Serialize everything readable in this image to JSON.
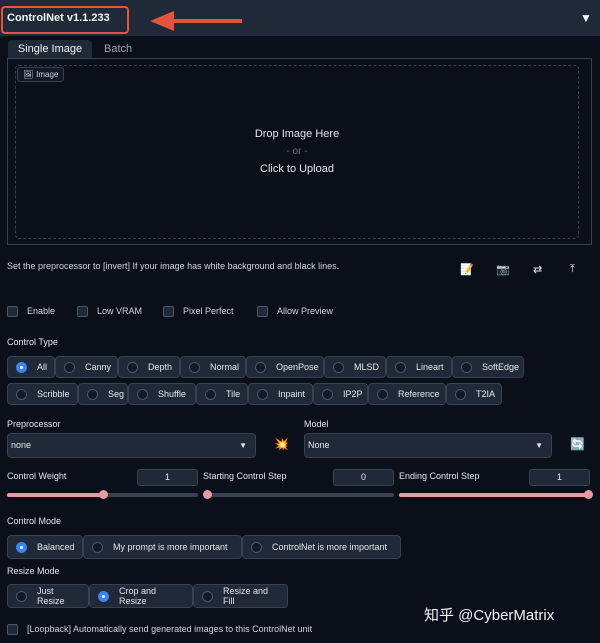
{
  "header": {
    "title": "ControlNet v1.1.233",
    "collapse_icon": "▼"
  },
  "tabs": [
    {
      "label": "Single Image"
    },
    {
      "label": "Batch"
    }
  ],
  "image_input": {
    "label": "Image",
    "drop_text": "Drop Image Here",
    "or_text": "- or -",
    "upload_text": "Click to Upload"
  },
  "hint": "Set the preprocessor to [invert] If your image has white background and black lines.",
  "toolbar": {
    "icons": [
      "edit-icon",
      "camera-icon",
      "swap-icon",
      "upload-arrow-icon"
    ],
    "glyphs": [
      "📝",
      "📷",
      "⇄",
      "⤒"
    ]
  },
  "options": [
    {
      "label": "Enable",
      "checked": false
    },
    {
      "label": "Low VRAM",
      "checked": false
    },
    {
      "label": "Pixel Perfect",
      "checked": false
    },
    {
      "label": "Allow Preview",
      "checked": false
    }
  ],
  "control_type": {
    "label": "Control Type",
    "selected": "All",
    "items": [
      "All",
      "Canny",
      "Depth",
      "Normal",
      "OpenPose",
      "MLSD",
      "Lineart",
      "SoftEdge",
      "Scribble",
      "Seg",
      "Shuffle",
      "Tile",
      "Inpaint",
      "IP2P",
      "Reference",
      "T2IA"
    ]
  },
  "preprocessor": {
    "label": "Preprocessor",
    "value": "none"
  },
  "run_icon": "💥",
  "model": {
    "label": "Model",
    "value": "None"
  },
  "refresh_icon": "🔄",
  "sliders": [
    {
      "label": "Control Weight",
      "value": "1",
      "fraction": 0.5
    },
    {
      "label": "Starting Control Step",
      "value": "0",
      "fraction": 0.0
    },
    {
      "label": "Ending Control Step",
      "value": "1",
      "fraction": 1.0
    }
  ],
  "control_mode": {
    "label": "Control Mode",
    "selected": "Balanced",
    "items": [
      "Balanced",
      "My prompt is more important",
      "ControlNet is more important"
    ]
  },
  "resize_mode": {
    "label": "Resize Mode",
    "selected": "Crop and Resize",
    "items": [
      "Just Resize",
      "Crop and Resize",
      "Resize and Fill"
    ]
  },
  "loopback": {
    "label": "[Loopback] Automatically send generated images to this ControlNet unit",
    "checked": false
  },
  "watermark": "知乎 @CyberMatrix",
  "colors": {
    "accent": "#3b82f6",
    "slider": "#e89aa1",
    "annotation": "#e5533f"
  }
}
